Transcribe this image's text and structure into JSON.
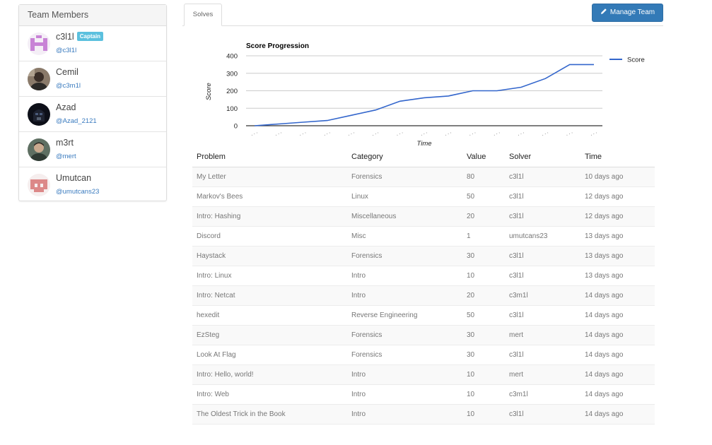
{
  "team_panel": {
    "title": "Team Members",
    "members": [
      {
        "name": "c3l1l",
        "handle": "@c3l1l",
        "badge": "Captain",
        "avatar": "pink-identicon"
      },
      {
        "name": "Cemil",
        "handle": "@c3m1l",
        "badge": "",
        "avatar": "photo"
      },
      {
        "name": "Azad",
        "handle": "@Azad_2121",
        "badge": "",
        "avatar": "vader-photo"
      },
      {
        "name": "m3rt",
        "handle": "@mert",
        "badge": "",
        "avatar": "photo"
      },
      {
        "name": "Umutcan",
        "handle": "@umutcans23",
        "badge": "",
        "avatar": "red-identicon"
      }
    ]
  },
  "tabs": [
    {
      "label": "Solves"
    }
  ],
  "manage_button": {
    "label": "Manage Team",
    "icon": "pencil-icon"
  },
  "chart_data": {
    "type": "line",
    "title": "Score Progression",
    "xlabel": "Time",
    "ylabel": "Score",
    "ylim": [
      0,
      400
    ],
    "yticks": [
      0,
      100,
      200,
      300,
      400
    ],
    "series": [
      {
        "name": "Score",
        "values": [
          0,
          10,
          20,
          30,
          60,
          90,
          140,
          160,
          170,
          200,
          200,
          220,
          270,
          350,
          350
        ]
      }
    ],
    "legend": "right",
    "grid": true,
    "colors": {
      "line": "#3366cc"
    }
  },
  "table": {
    "headers": [
      "Problem",
      "Category",
      "Value",
      "Solver",
      "Time"
    ],
    "rows": [
      [
        "My Letter",
        "Forensics",
        "80",
        "c3l1l",
        "10 days ago"
      ],
      [
        "Markov's Bees",
        "Linux",
        "50",
        "c3l1l",
        "12 days ago"
      ],
      [
        "Intro: Hashing",
        "Miscellaneous",
        "20",
        "c3l1l",
        "12 days ago"
      ],
      [
        "Discord",
        "Misc",
        "1",
        "umutcans23",
        "13 days ago"
      ],
      [
        "Haystack",
        "Forensics",
        "30",
        "c3l1l",
        "13 days ago"
      ],
      [
        "Intro: Linux",
        "Intro",
        "10",
        "c3l1l",
        "13 days ago"
      ],
      [
        "Intro: Netcat",
        "Intro",
        "20",
        "c3m1l",
        "14 days ago"
      ],
      [
        "hexedit",
        "Reverse Engineering",
        "50",
        "c3l1l",
        "14 days ago"
      ],
      [
        "EzSteg",
        "Forensics",
        "30",
        "mert",
        "14 days ago"
      ],
      [
        "Look At Flag",
        "Forensics",
        "30",
        "c3l1l",
        "14 days ago"
      ],
      [
        "Intro: Hello, world!",
        "Intro",
        "10",
        "mert",
        "14 days ago"
      ],
      [
        "Intro: Web",
        "Intro",
        "10",
        "c3m1l",
        "14 days ago"
      ],
      [
        "The Oldest Trick in the Book",
        "Intro",
        "10",
        "c3l1l",
        "14 days ago"
      ]
    ]
  }
}
